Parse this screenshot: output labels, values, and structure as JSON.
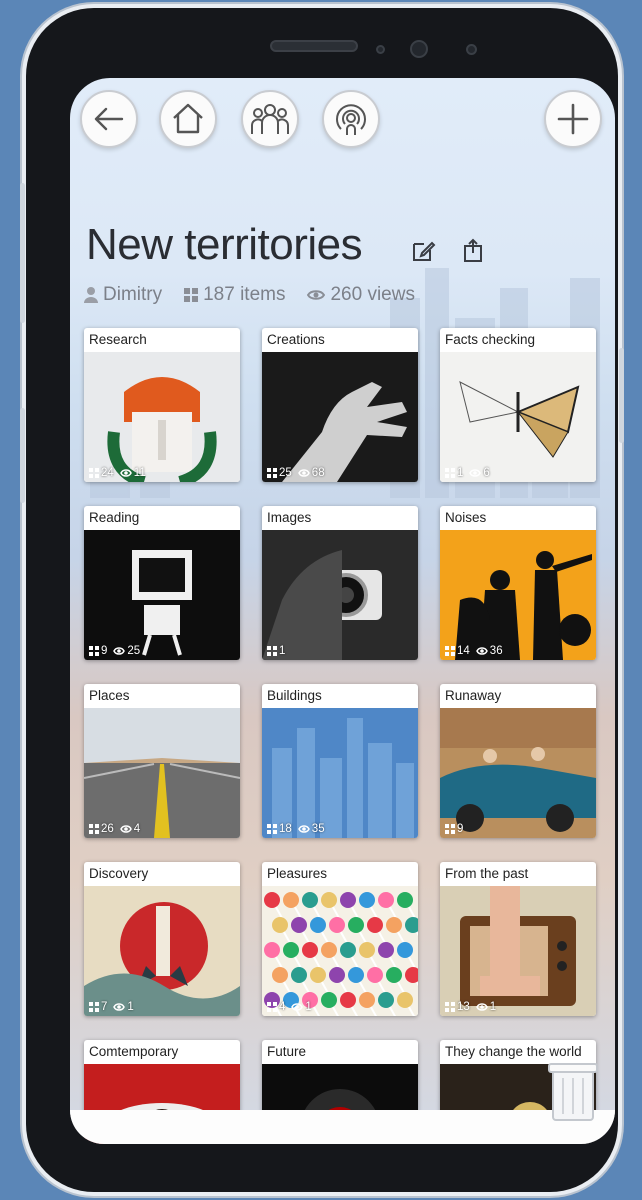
{
  "collection": {
    "title": "New territories",
    "author": "Dimitry",
    "items_count": "187 items",
    "views_count": "260 views"
  },
  "toolbar": {
    "back": "back",
    "home": "home",
    "people": "people",
    "broadcast": "broadcast",
    "add": "add"
  },
  "cards": [
    {
      "label": "Research",
      "items": "24",
      "views": "11"
    },
    {
      "label": "Creations",
      "items": "25",
      "views": "68"
    },
    {
      "label": "Facts checking",
      "items": "1",
      "views": "6"
    },
    {
      "label": "Reading",
      "items": "9",
      "views": "25"
    },
    {
      "label": "Images",
      "items": "1",
      "views": ""
    },
    {
      "label": "Noises",
      "items": "14",
      "views": "36"
    },
    {
      "label": "Places",
      "items": "26",
      "views": "4"
    },
    {
      "label": "Buildings",
      "items": "18",
      "views": "35"
    },
    {
      "label": "Runaway",
      "items": "9",
      "views": ""
    },
    {
      "label": "Discovery",
      "items": "7",
      "views": "1"
    },
    {
      "label": "Pleasures",
      "items": "4",
      "views": "1"
    },
    {
      "label": "From the past",
      "items": "13",
      "views": "1"
    },
    {
      "label": "Comtemporary",
      "items": "",
      "views": ""
    },
    {
      "label": "Future",
      "items": "",
      "views": ""
    },
    {
      "label": "They change the world",
      "items": "",
      "views": ""
    }
  ],
  "colors": {
    "background": "#5b86b7",
    "phone_frame": "#15171b",
    "title_text": "#2a2d33",
    "meta_text": "#7c8089"
  }
}
